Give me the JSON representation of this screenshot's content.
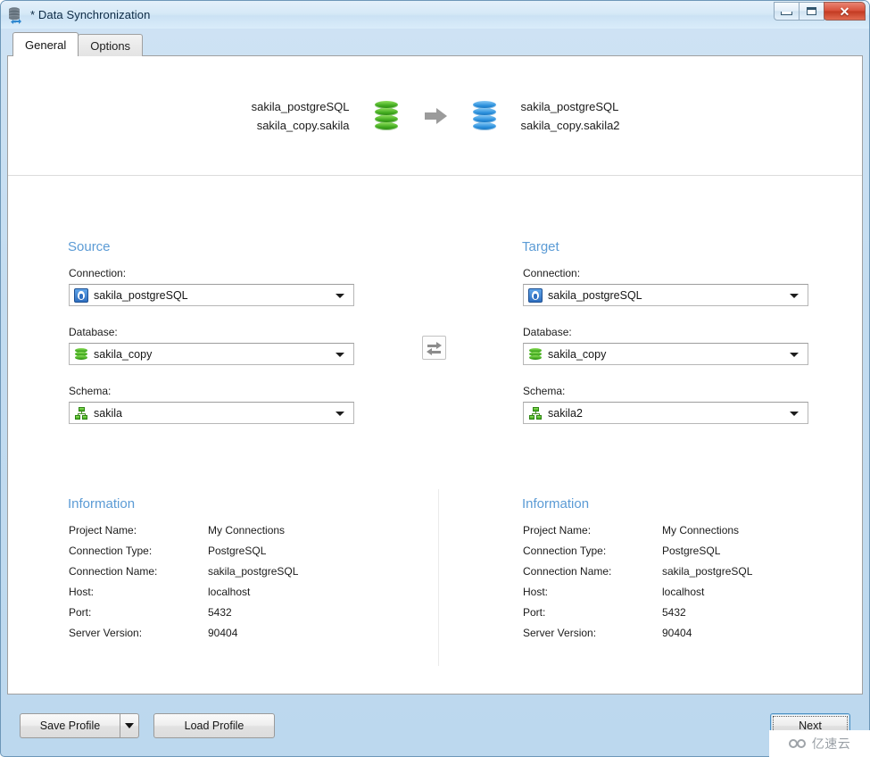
{
  "window": {
    "title": "* Data Synchronization",
    "icon": "data-sync-icon",
    "controls": {
      "minimize": "minimize-button",
      "maximize": "maximize-button",
      "close": "✕"
    }
  },
  "tabs": [
    {
      "label": "General",
      "active": true
    },
    {
      "label": "Options",
      "active": false
    }
  ],
  "summary": {
    "source_line1": "sakila_postgreSQL",
    "source_line2": "sakila_copy.sakila",
    "target_line1": "sakila_postgreSQL",
    "target_line2": "sakila_copy.sakila2",
    "source_icon": "database-green-icon",
    "arrow_icon": "arrow-right-icon",
    "target_icon": "database-blue-icon"
  },
  "source": {
    "heading": "Source",
    "connection_label": "Connection:",
    "connection_value": "sakila_postgreSQL",
    "connection_icon": "postgresql-icon",
    "database_label": "Database:",
    "database_value": "sakila_copy",
    "database_icon": "database-green-icon",
    "schema_label": "Schema:",
    "schema_value": "sakila",
    "schema_icon": "schema-icon"
  },
  "target": {
    "heading": "Target",
    "connection_label": "Connection:",
    "connection_value": "sakila_postgreSQL",
    "connection_icon": "postgresql-icon",
    "database_label": "Database:",
    "database_value": "sakila_copy",
    "database_icon": "database-green-icon",
    "schema_label": "Schema:",
    "schema_value": "sakila2",
    "schema_icon": "schema-icon"
  },
  "swap": {
    "icon": "swap-arrows-icon"
  },
  "info_left": {
    "heading": "Information",
    "rows": [
      {
        "label": "Project Name:",
        "value": "My Connections"
      },
      {
        "label": "Connection Type:",
        "value": "PostgreSQL"
      },
      {
        "label": "Connection Name:",
        "value": "sakila_postgreSQL"
      },
      {
        "label": "Host:",
        "value": "localhost"
      },
      {
        "label": "Port:",
        "value": "5432"
      },
      {
        "label": "Server Version:",
        "value": "90404"
      }
    ]
  },
  "info_right": {
    "heading": "Information",
    "rows": [
      {
        "label": "Project Name:",
        "value": "My Connections"
      },
      {
        "label": "Connection Type:",
        "value": "PostgreSQL"
      },
      {
        "label": "Connection Name:",
        "value": "sakila_postgreSQL"
      },
      {
        "label": "Host:",
        "value": "localhost"
      },
      {
        "label": "Port:",
        "value": "5432"
      },
      {
        "label": "Server Version:",
        "value": "90404"
      }
    ]
  },
  "buttons": {
    "save_profile": "Save Profile",
    "save_profile_arrow": "chevron-down-icon",
    "load_profile": "Load Profile",
    "next": "Next"
  },
  "watermark": {
    "text": "亿速云",
    "logo": "cloud-logo-icon"
  },
  "colors": {
    "accent_heading": "#5b9bd5",
    "source_db": "#3fa91d",
    "target_db": "#2a8fdc",
    "titlebar": "#d6e9f7",
    "close_button": "#c23a22"
  }
}
